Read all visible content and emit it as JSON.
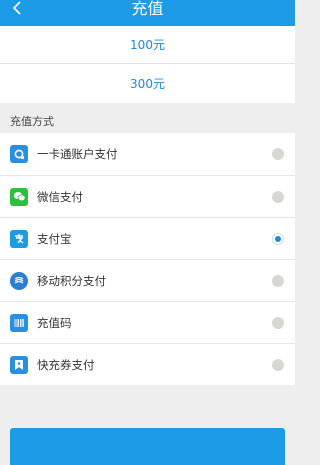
{
  "header": {
    "title": "充值",
    "back_icon": "chevron-left-icon"
  },
  "amounts": [
    "100元",
    "300元"
  ],
  "section_label": "充值方式",
  "payment_methods": [
    {
      "label": "一卡通账户支付",
      "icon": "card-account-icon",
      "color": "#2a8fe0",
      "selected": false
    },
    {
      "label": "微信支付",
      "icon": "wechat-icon",
      "color": "#2bbf3a",
      "selected": false
    },
    {
      "label": "支付宝",
      "icon": "alipay-icon",
      "color": "#1e9be6",
      "selected": true
    },
    {
      "label": "移动积分支付",
      "icon": "china-mobile-icon",
      "color": "#2a7fd4",
      "selected": false
    },
    {
      "label": "充值码",
      "icon": "barcode-icon",
      "color": "#2a8fe0",
      "selected": false
    },
    {
      "label": "快充券支付",
      "icon": "coupon-icon",
      "color": "#2a8fe0",
      "selected": false
    }
  ],
  "colors": {
    "accent": "#1e9be6",
    "link": "#1e88e5"
  }
}
